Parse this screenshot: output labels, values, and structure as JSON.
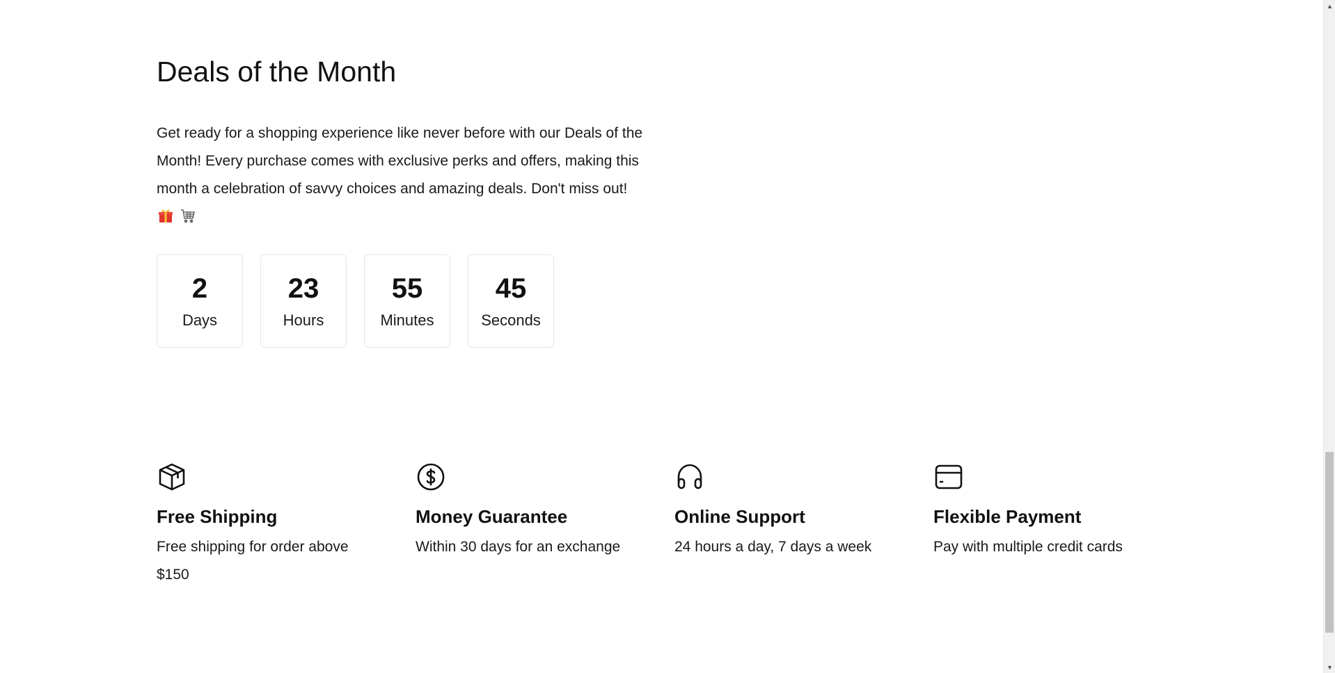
{
  "deals": {
    "title": "Deals of the Month",
    "description": "Get ready for a shopping experience like never before with our Deals of the Month! Every purchase comes with exclusive perks and offers, making this month a celebration of savvy choices and amazing deals. Don't miss out!",
    "emojis": [
      "🎁",
      "🛒"
    ],
    "countdown": {
      "days": {
        "value": "2",
        "label": "Days"
      },
      "hours": {
        "value": "23",
        "label": "Hours"
      },
      "minutes": {
        "value": "55",
        "label": "Minutes"
      },
      "seconds": {
        "value": "45",
        "label": "Seconds"
      }
    }
  },
  "features": [
    {
      "icon": "package-icon",
      "title": "Free Shipping",
      "text": "Free shipping for order above $150"
    },
    {
      "icon": "dollar-coin-icon",
      "title": "Money Guarantee",
      "text": "Within 30 days for an exchange"
    },
    {
      "icon": "headphones-icon",
      "title": "Online Support",
      "text": "24 hours a day, 7 days a week"
    },
    {
      "icon": "credit-card-icon",
      "title": "Flexible Payment",
      "text": "Pay with multiple credit cards"
    }
  ],
  "colors": {
    "text": "#111111",
    "border": "#e6e6e6",
    "background": "#ffffff",
    "scrollbar_thumb": "#c1c1c1"
  }
}
